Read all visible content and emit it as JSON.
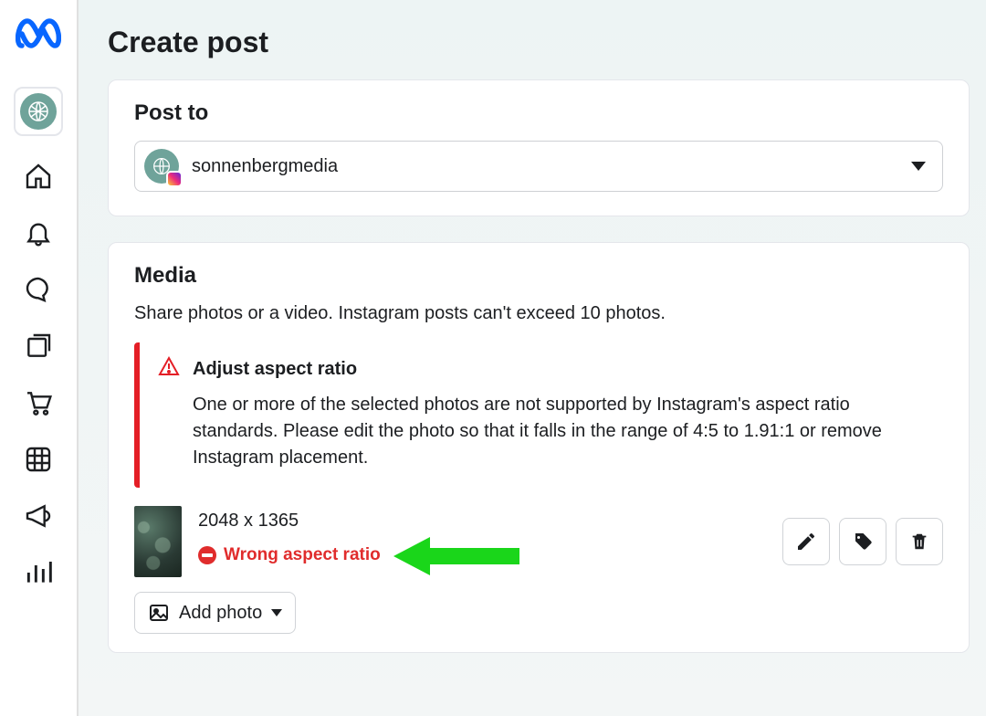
{
  "page": {
    "title": "Create post"
  },
  "post_to": {
    "label": "Post to",
    "account_name": "sonnenbergmedia"
  },
  "media": {
    "label": "Media",
    "subtitle": "Share photos or a video. Instagram posts can't exceed 10 photos.",
    "warning": {
      "title": "Adjust aspect ratio",
      "body": "One or more of the selected photos are not supported by Instagram's aspect ratio standards. Please edit the photo so that it falls in the range of 4:5 to 1.91:1 or remove Instagram placement."
    },
    "item": {
      "dimensions": "2048 x 1365",
      "error": "Wrong aspect ratio"
    },
    "add_photo_label": "Add photo"
  },
  "icons": {
    "nav": [
      "home",
      "bell",
      "chat",
      "pages",
      "cart",
      "grid",
      "megaphone",
      "bars"
    ]
  },
  "colors": {
    "accent": "#0866ff",
    "error": "#e02c2c",
    "warning_border": "#e41e26",
    "avatar": "#6fa39a",
    "arrow": "#1ad61a"
  }
}
